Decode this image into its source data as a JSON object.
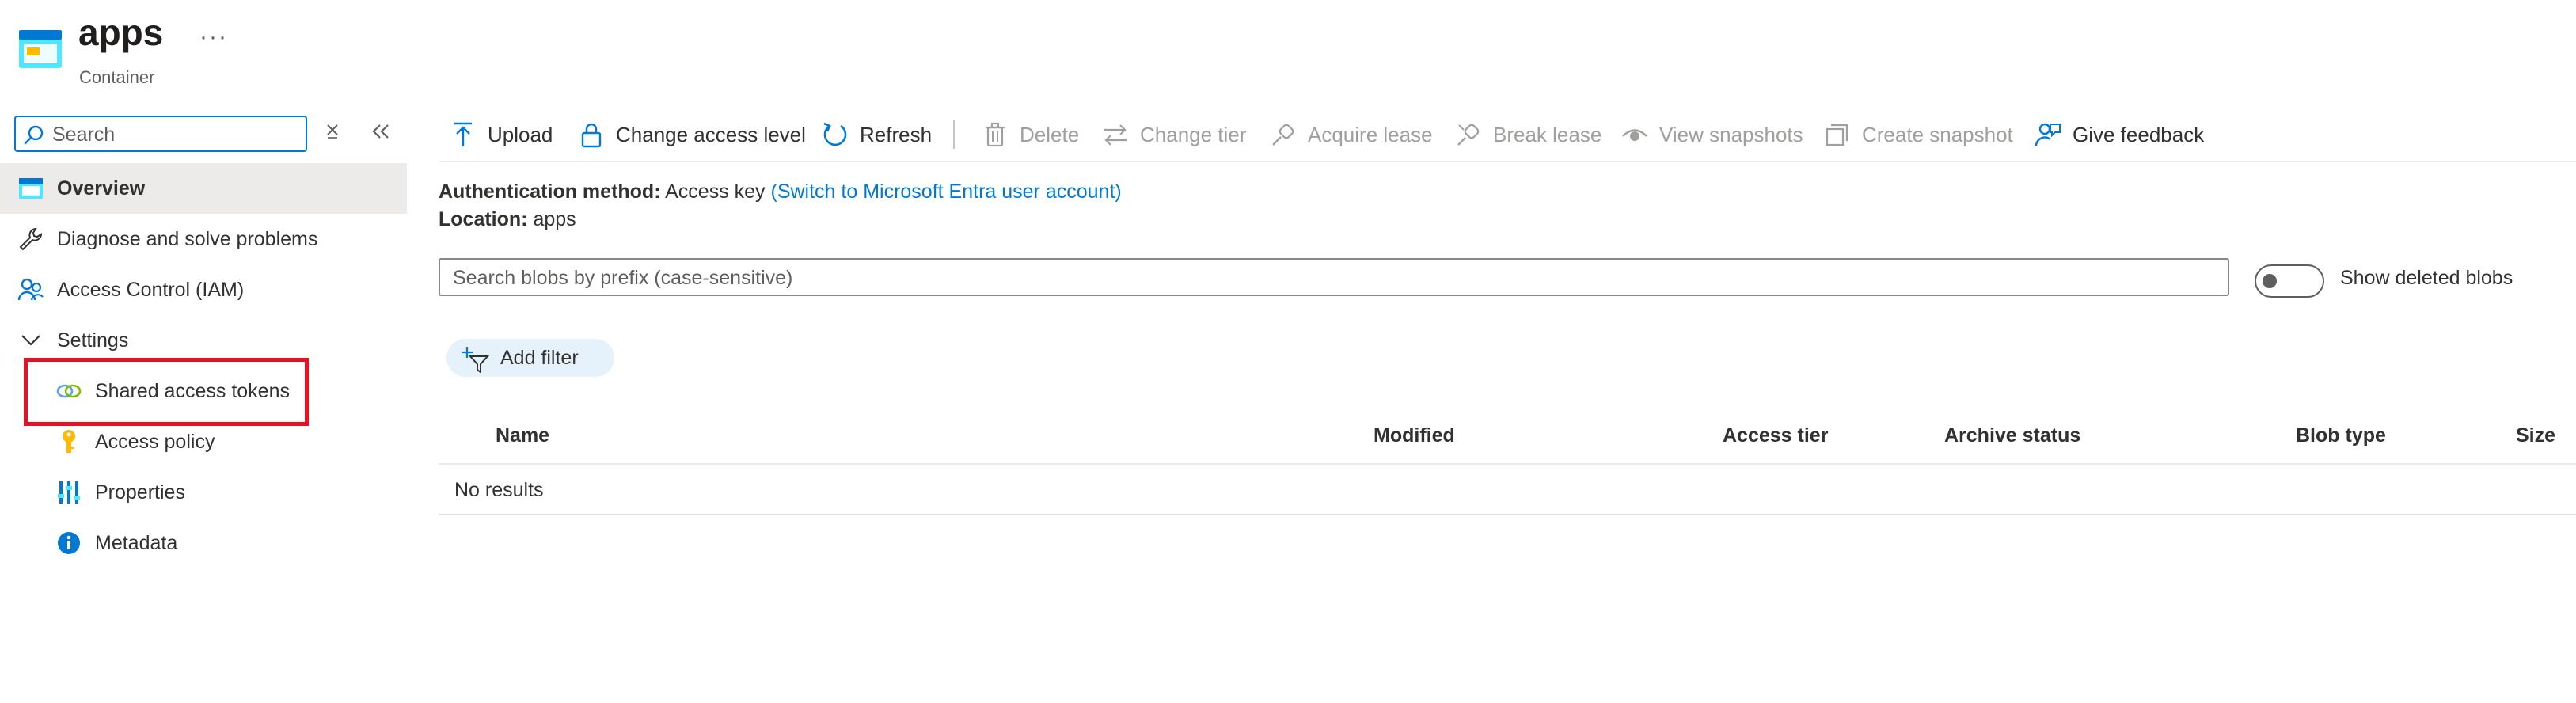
{
  "header": {
    "title": "apps",
    "subtitle": "Container",
    "more_label": "···"
  },
  "nav": {
    "search_placeholder": "Search",
    "items": [
      {
        "label": "Overview",
        "icon": "container-icon",
        "selected": true
      },
      {
        "label": "Diagnose and solve problems",
        "icon": "wrench-icon"
      },
      {
        "label": "Access Control (IAM)",
        "icon": "people-icon"
      },
      {
        "label": "Settings",
        "icon": "chevron-down-icon",
        "group": true
      },
      {
        "label": "Shared access tokens",
        "icon": "link-chain-icon",
        "highlighted": true
      },
      {
        "label": "Access policy",
        "icon": "key-icon"
      },
      {
        "label": "Properties",
        "icon": "sliders-icon"
      },
      {
        "label": "Metadata",
        "icon": "info-icon"
      }
    ]
  },
  "toolbar": {
    "upload": "Upload",
    "change_access_level": "Change access level",
    "refresh": "Refresh",
    "delete": "Delete",
    "change_tier": "Change tier",
    "acquire_lease": "Acquire lease",
    "break_lease": "Break lease",
    "view_snapshots": "View snapshots",
    "create_snapshot": "Create snapshot",
    "give_feedback": "Give feedback"
  },
  "info": {
    "auth_label": "Authentication method:",
    "auth_value": "Access key",
    "auth_link": "(Switch to Microsoft Entra user account)",
    "location_label": "Location:",
    "location_value": "apps"
  },
  "blob_search": {
    "placeholder": "Search blobs by prefix (case-sensitive)"
  },
  "show_deleted": {
    "label": "Show deleted blobs",
    "on": false
  },
  "add_filter": "Add filter",
  "table": {
    "columns": [
      "Name",
      "Modified",
      "Access tier",
      "Archive status",
      "Blob type",
      "Size"
    ],
    "empty_text": "No results"
  },
  "colors": {
    "accent": "#0078d4",
    "highlight_border": "#e81123",
    "disabled_text": "#a19f9d",
    "selected_bg": "#edebe9"
  }
}
